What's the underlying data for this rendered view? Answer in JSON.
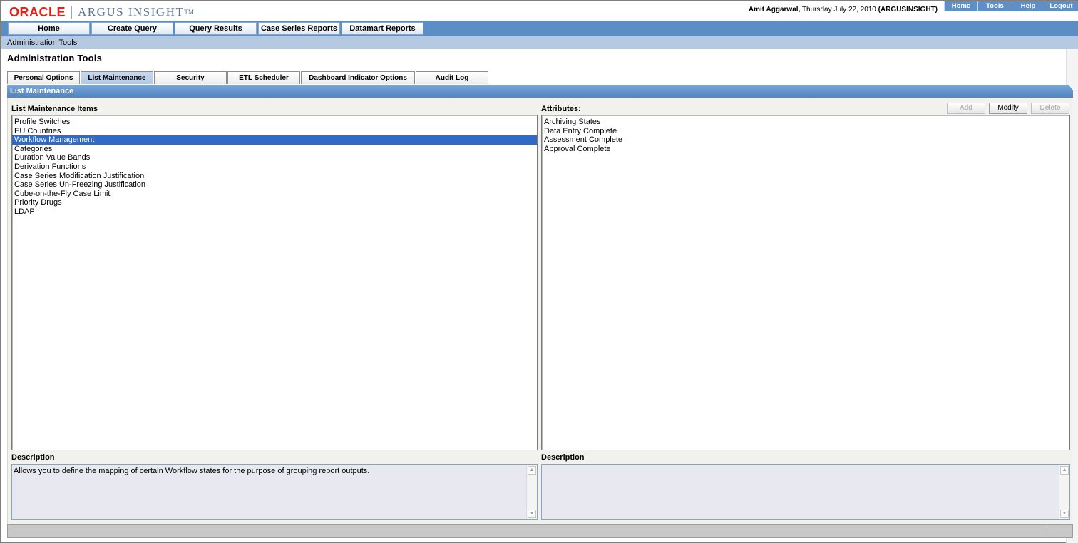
{
  "header": {
    "logo_oracle": "ORACLE",
    "logo_argus": "ARGUS INSIGHT",
    "logo_tm": "TM",
    "user_name": "Amit Aggarwal,",
    "date_text": "Thursday July 22, 2010",
    "db_text": "(ARGUSINSIGHT)",
    "top_links": [
      "Home",
      "Tools",
      "Help",
      "Logout"
    ]
  },
  "main_nav": [
    "Home",
    "Create Query",
    "Query Results",
    "Case Series Reports",
    "Datamart Reports"
  ],
  "breadcrumb": "Administration Tools",
  "page_title": "Administration Tools",
  "tabs": [
    "Personal Options",
    "List Maintenance",
    "Security",
    "ETL Scheduler",
    "Dashboard Indicator Options",
    "Audit Log"
  ],
  "active_tab": "List Maintenance",
  "section_title": "List Maintenance",
  "left_panel": {
    "label": "List Maintenance Items",
    "items": [
      "Profile Switches",
      "EU Countries",
      "Workflow Management",
      "Categories",
      "Duration Value Bands",
      "Derivation Functions",
      "Case Series Modification Justification",
      "Case Series Un-Freezing Justification",
      "Cube-on-the-Fly Case Limit",
      "Priority Drugs",
      "LDAP"
    ],
    "selected": "Workflow Management",
    "description_label": "Description",
    "description": "Allows you to define the mapping of certain Workflow states for the purpose of grouping report outputs."
  },
  "right_panel": {
    "label": "Attributes:",
    "buttons": {
      "add": "Add",
      "modify": "Modify",
      "delete": "Delete"
    },
    "items": [
      "Archiving States",
      "Data Entry Complete",
      "Assessment Complete",
      "Approval Complete"
    ],
    "description_label": "Description",
    "description": ""
  },
  "colors": {
    "nav_blue": "#5b8ec5",
    "breadcrumb_blue": "#b6c9e3",
    "selection_blue": "#316ac5",
    "oracle_red": "#e2231a"
  }
}
